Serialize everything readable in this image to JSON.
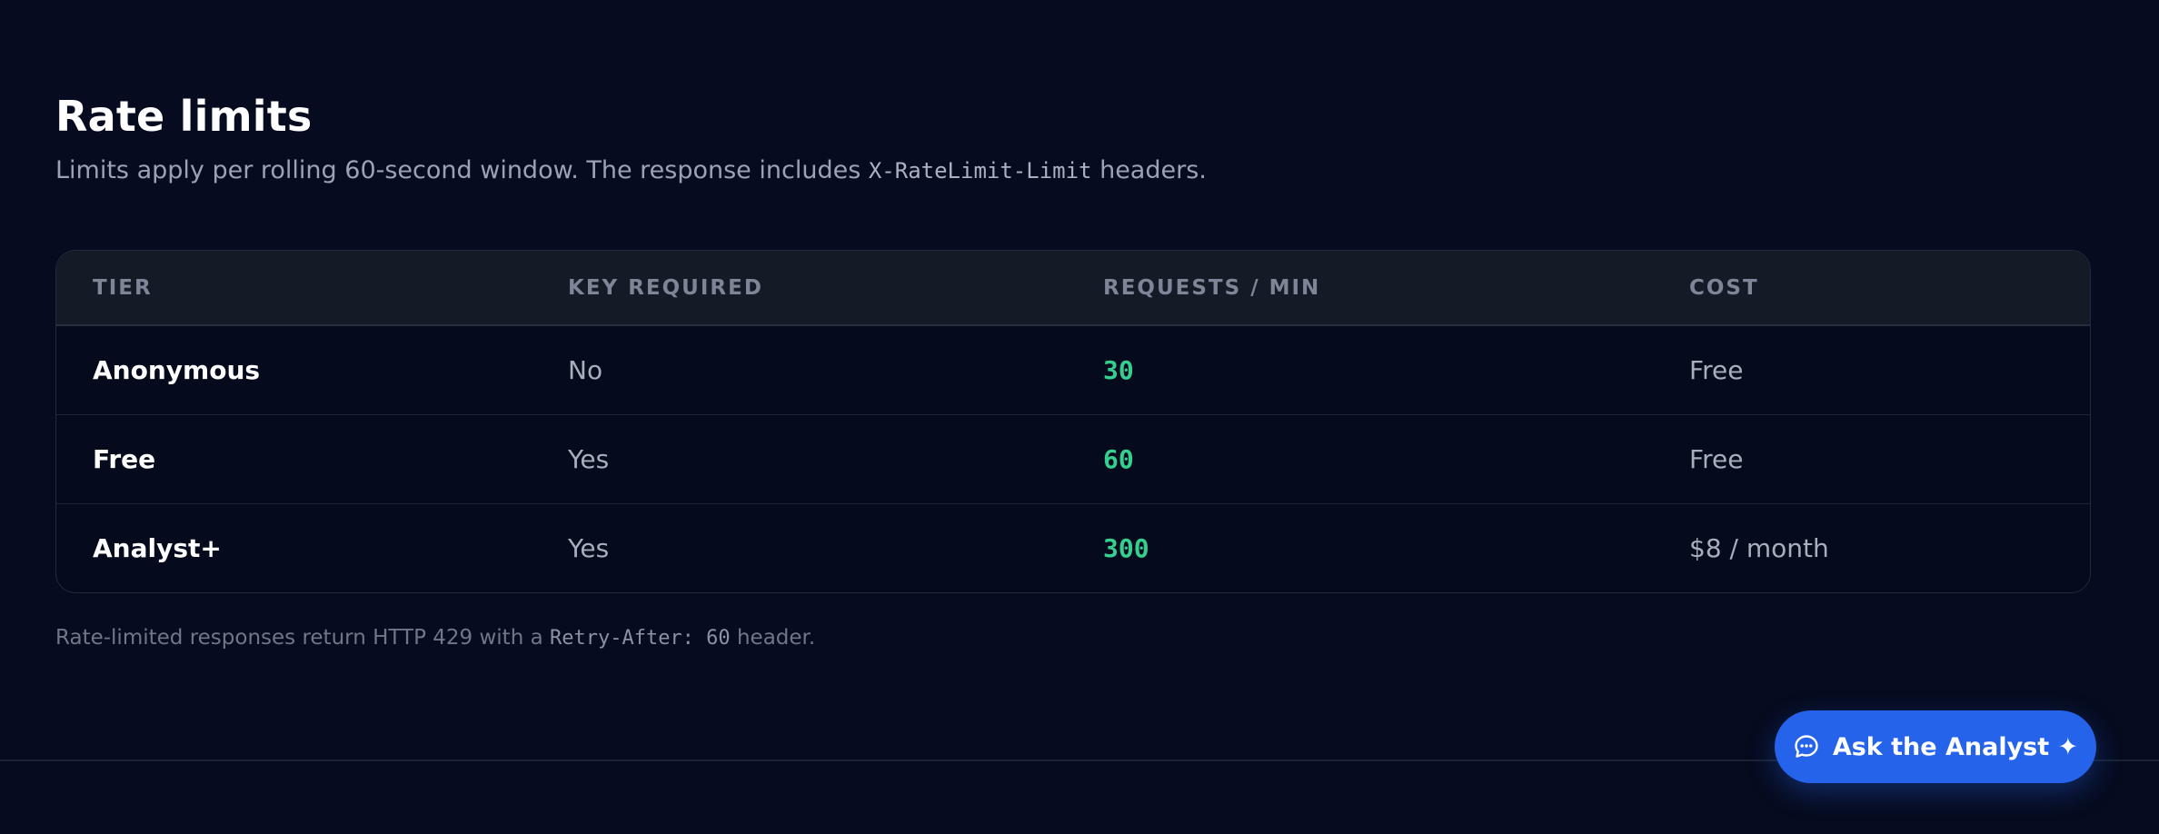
{
  "section": {
    "title": "Rate limits",
    "subtitle_before": "Limits apply per rolling 60-second window. The response includes ",
    "subtitle_code": "X-RateLimit-Limit",
    "subtitle_after": " headers."
  },
  "table": {
    "headers": [
      "TIER",
      "KEY REQUIRED",
      "REQUESTS / MIN",
      "COST"
    ],
    "rows": [
      {
        "tier": "Anonymous",
        "key_required": "No",
        "requests_per_min": "30",
        "cost": "Free"
      },
      {
        "tier": "Free",
        "key_required": "Yes",
        "requests_per_min": "60",
        "cost": "Free"
      },
      {
        "tier": "Analyst+",
        "key_required": "Yes",
        "requests_per_min": "300",
        "cost": "$8 / month"
      }
    ]
  },
  "footnote": {
    "before": "Rate-limited responses return HTTP 429 with a ",
    "code": "Retry-After: 60",
    "after": " header."
  },
  "ask_button": {
    "label": "Ask the Analyst ✦",
    "icon": "chat-bubble-icon"
  },
  "colors": {
    "background": "#060b1f",
    "accent": "#2563eb",
    "rate_value": "#35d08f"
  }
}
